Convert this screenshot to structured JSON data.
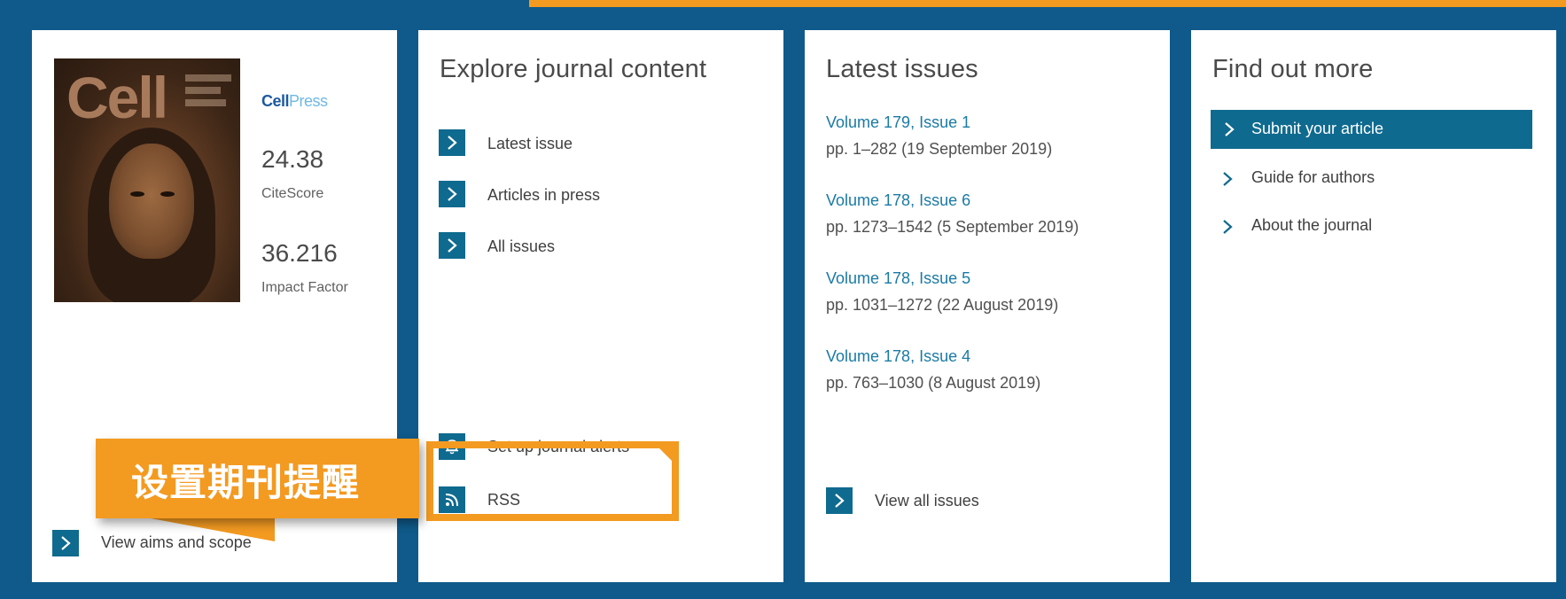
{
  "colors": {
    "brand_blue": "#0f5a8a",
    "button_teal": "#0f6a8f",
    "link_blue": "#1a7aa5",
    "callout_orange": "#f39a21"
  },
  "journal": {
    "cover_title": "Cell",
    "publisher_logo": "CellPress",
    "metrics": [
      {
        "value": "24.38",
        "label": "CiteScore"
      },
      {
        "value": "36.216",
        "label": "Impact Factor"
      }
    ],
    "aims_link": "View aims and scope"
  },
  "explore": {
    "title": "Explore journal content",
    "links": [
      "Latest issue",
      "Articles in press",
      "All issues"
    ],
    "alerts_link": "Set up journal alerts",
    "rss_link": "RSS"
  },
  "latest_issues": {
    "title": "Latest issues",
    "issues": [
      {
        "volume": "Volume 179, Issue 1",
        "pages": "pp. 1–282 (19 September 2019)"
      },
      {
        "volume": "Volume 178, Issue 6",
        "pages": "pp. 1273–1542 (5 September 2019)"
      },
      {
        "volume": "Volume 178, Issue 5",
        "pages": "pp. 1031–1272 (22 August 2019)"
      },
      {
        "volume": "Volume 178, Issue 4",
        "pages": "pp. 763–1030 (8 August 2019)"
      }
    ],
    "view_all": "View all issues"
  },
  "find_out_more": {
    "title": "Find out more",
    "active_link": "Submit your article",
    "links": [
      "Guide for authors",
      "About the journal"
    ]
  },
  "annotation": {
    "callout_text": "设置期刊提醒"
  }
}
